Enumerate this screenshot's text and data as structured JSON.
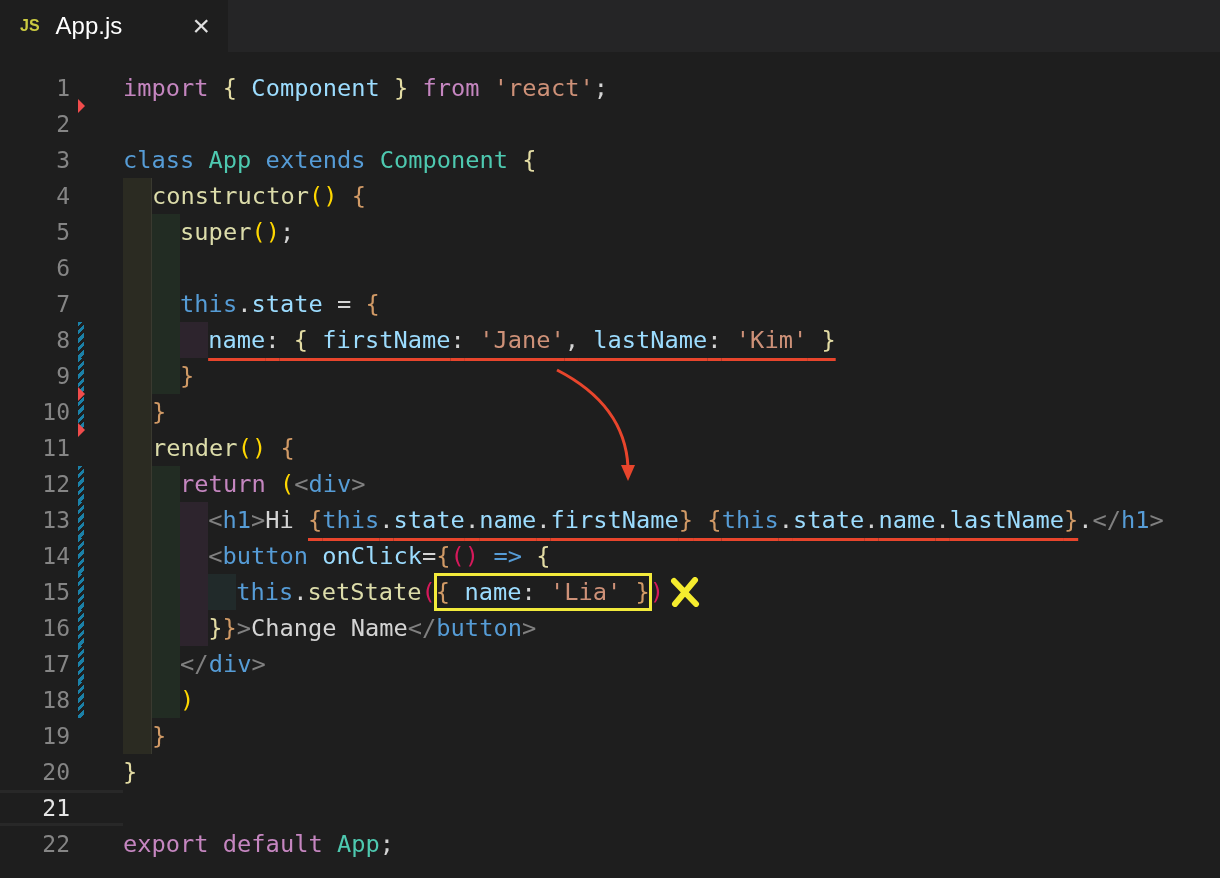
{
  "tabs": [
    {
      "icon_text": "JS",
      "label": "App.js",
      "close": "×",
      "selected": true
    }
  ],
  "lines": [
    {
      "number": "1",
      "modified": false,
      "deleted_after": true,
      "current": false,
      "cross_mark": false,
      "tokens": [
        {
          "text": "import",
          "kind": "kw"
        },
        {
          "text": " {",
          "kind": "b1"
        },
        {
          "text": " Component",
          "kind": "var"
        },
        {
          "text": " }",
          "kind": "b1"
        },
        {
          "text": " from",
          "kind": "kw"
        },
        {
          "text": " 'react'",
          "kind": "str"
        },
        {
          "text": ";",
          "kind": "punc"
        }
      ]
    },
    {
      "number": "2",
      "modified": false,
      "deleted_after": false,
      "current": false,
      "cross_mark": false
    },
    {
      "number": "3",
      "modified": false,
      "deleted_after": false,
      "current": false,
      "cross_mark": false,
      "tokens": [
        {
          "text": "class",
          "kind": "storage"
        },
        {
          "text": " App",
          "kind": "type"
        },
        {
          "text": " extends",
          "kind": "storage"
        },
        {
          "text": " Component",
          "kind": "type"
        },
        {
          "text": " {",
          "kind": "b1"
        }
      ]
    },
    {
      "number": "4",
      "modified": false,
      "deleted_after": false,
      "current": false,
      "cross_mark": false,
      "tokens": [
        {
          "text": "  constructor",
          "kind": "fn"
        },
        {
          "text": "()",
          "kind": "b2"
        },
        {
          "text": " {",
          "kind": "b3"
        }
      ]
    },
    {
      "number": "5",
      "modified": false,
      "deleted_after": false,
      "current": false,
      "cross_mark": false,
      "tokens": [
        {
          "text": "    super",
          "kind": "fn"
        },
        {
          "text": "()",
          "kind": "b2"
        },
        {
          "text": ";",
          "kind": "punc"
        }
      ]
    },
    {
      "number": "6",
      "modified": false,
      "deleted_after": false,
      "current": false,
      "cross_mark": false
    },
    {
      "number": "7",
      "modified": false,
      "deleted_after": false,
      "current": false,
      "cross_mark": false,
      "tokens": [
        {
          "text": "    this",
          "kind": "storage"
        },
        {
          "text": ".",
          "kind": "punc"
        },
        {
          "text": "state",
          "kind": "var"
        },
        {
          "text": " =",
          "kind": "punc"
        },
        {
          "text": " {",
          "kind": "b3"
        }
      ]
    },
    {
      "number": "8",
      "modified": true,
      "deleted_after": false,
      "current": false,
      "cross_mark": false,
      "tokens": [
        {
          "kind": "underline",
          "tokens": [
            {
              "text": "      name",
              "kind": "var"
            },
            {
              "text": ":",
              "kind": "punc"
            },
            {
              "text": " {",
              "kind": "b1"
            },
            {
              "text": " firstName",
              "kind": "var"
            },
            {
              "text": ":",
              "kind": "punc"
            },
            {
              "text": " 'Jane'",
              "kind": "str"
            },
            {
              "text": ",",
              "kind": "punc"
            },
            {
              "text": " lastName",
              "kind": "var"
            },
            {
              "text": ":",
              "kind": "punc"
            },
            {
              "text": " 'Kim'",
              "kind": "str"
            },
            {
              "text": " }",
              "kind": "b1"
            }
          ]
        }
      ]
    },
    {
      "number": "9",
      "modified": true,
      "deleted_after": true,
      "current": false,
      "cross_mark": false,
      "tokens": [
        {
          "text": "    }",
          "kind": "b3"
        }
      ]
    },
    {
      "number": "10",
      "modified": true,
      "deleted_after": true,
      "current": false,
      "cross_mark": false,
      "tokens": [
        {
          "text": "  }",
          "kind": "b3"
        }
      ]
    },
    {
      "number": "11",
      "modified": false,
      "deleted_after": false,
      "current": false,
      "cross_mark": false,
      "tokens": [
        {
          "text": "  render",
          "kind": "fn"
        },
        {
          "text": "()",
          "kind": "b2"
        },
        {
          "text": " {",
          "kind": "b3"
        }
      ]
    },
    {
      "number": "12",
      "modified": true,
      "deleted_after": false,
      "current": false,
      "cross_mark": false,
      "tokens": [
        {
          "text": "    return",
          "kind": "kw"
        },
        {
          "text": " (",
          "kind": "b2"
        },
        {
          "text": "<",
          "kind": "tag"
        },
        {
          "text": "div",
          "kind": "tagname"
        },
        {
          "text": ">",
          "kind": "tag"
        }
      ]
    },
    {
      "number": "13",
      "modified": true,
      "deleted_after": false,
      "current": false,
      "cross_mark": false,
      "tokens": [
        {
          "text": "      <",
          "kind": "tag"
        },
        {
          "text": "h1",
          "kind": "tagname"
        },
        {
          "text": ">",
          "kind": "tag"
        },
        {
          "text": "Hi ",
          "kind": "punc"
        },
        {
          "kind": "underline",
          "tokens": [
            {
              "text": "{",
              "kind": "b3"
            },
            {
              "text": "this",
              "kind": "storage"
            },
            {
              "text": ".",
              "kind": "punc"
            },
            {
              "text": "state",
              "kind": "var"
            },
            {
              "text": ".",
              "kind": "punc"
            },
            {
              "text": "name",
              "kind": "var"
            },
            {
              "text": ".",
              "kind": "punc"
            },
            {
              "text": "firstName",
              "kind": "var"
            },
            {
              "text": "}",
              "kind": "b3"
            },
            {
              "text": " {",
              "kind": "b3"
            },
            {
              "text": "this",
              "kind": "storage"
            },
            {
              "text": ".",
              "kind": "punc"
            },
            {
              "text": "state",
              "kind": "var"
            },
            {
              "text": ".",
              "kind": "punc"
            },
            {
              "text": "name",
              "kind": "var"
            },
            {
              "text": ".",
              "kind": "punc"
            },
            {
              "text": "lastName",
              "kind": "var"
            },
            {
              "text": "}",
              "kind": "b3"
            }
          ]
        },
        {
          "text": ".",
          "kind": "punc"
        },
        {
          "text": "</",
          "kind": "tag"
        },
        {
          "text": "h1",
          "kind": "tagname"
        },
        {
          "text": ">",
          "kind": "tag"
        }
      ]
    },
    {
      "number": "14",
      "modified": true,
      "deleted_after": false,
      "current": false,
      "cross_mark": false,
      "tokens": [
        {
          "text": "      <",
          "kind": "tag"
        },
        {
          "text": "button",
          "kind": "tagname"
        },
        {
          "text": " onClick",
          "kind": "var"
        },
        {
          "text": "=",
          "kind": "punc"
        },
        {
          "text": "{",
          "kind": "b3"
        },
        {
          "text": "()",
          "kind": "b4"
        },
        {
          "text": " =>",
          "kind": "storage"
        },
        {
          "text": " {",
          "kind": "b1"
        }
      ]
    },
    {
      "number": "15",
      "modified": true,
      "deleted_after": false,
      "current": false,
      "cross_mark": true,
      "tokens": [
        {
          "text": "        this",
          "kind": "storage"
        },
        {
          "text": ".",
          "kind": "punc"
        },
        {
          "text": "setState",
          "kind": "fn"
        },
        {
          "text": "(",
          "kind": "b4"
        },
        {
          "kind": "box",
          "tokens": [
            {
              "text": "{",
              "kind": "b3"
            },
            {
              "text": " name",
              "kind": "var"
            },
            {
              "text": ":",
              "kind": "punc"
            },
            {
              "text": " 'Lia'",
              "kind": "str"
            },
            {
              "text": " }",
              "kind": "b3"
            }
          ]
        },
        {
          "text": ")",
          "kind": "b4"
        }
      ]
    },
    {
      "number": "16",
      "modified": true,
      "deleted_after": false,
      "current": false,
      "cross_mark": false,
      "tokens": [
        {
          "text": "      }",
          "kind": "b1"
        },
        {
          "text": "}",
          "kind": "b3"
        },
        {
          "text": ">",
          "kind": "tag"
        },
        {
          "text": "Change Name",
          "kind": "punc"
        },
        {
          "text": "</",
          "kind": "tag"
        },
        {
          "text": "button",
          "kind": "tagname"
        },
        {
          "text": ">",
          "kind": "tag"
        }
      ]
    },
    {
      "number": "17",
      "modified": true,
      "deleted_after": false,
      "current": false,
      "cross_mark": false,
      "tokens": [
        {
          "text": "    </",
          "kind": "tag"
        },
        {
          "text": "div",
          "kind": "tagname"
        },
        {
          "text": ">",
          "kind": "tag"
        }
      ]
    },
    {
      "number": "18",
      "modified": true,
      "deleted_after": false,
      "current": false,
      "cross_mark": false,
      "tokens": [
        {
          "text": "    )",
          "kind": "b2"
        }
      ]
    },
    {
      "number": "19",
      "modified": false,
      "deleted_after": false,
      "current": false,
      "cross_mark": false,
      "tokens": [
        {
          "text": "  }",
          "kind": "b3"
        }
      ]
    },
    {
      "number": "20",
      "modified": false,
      "deleted_after": false,
      "current": false,
      "cross_mark": false,
      "tokens": [
        {
          "text": "}",
          "kind": "b1"
        }
      ]
    },
    {
      "number": "21",
      "modified": false,
      "deleted_after": false,
      "current": true,
      "cross_mark": false
    },
    {
      "number": "22",
      "modified": false,
      "deleted_after": false,
      "current": false,
      "cross_mark": false,
      "tokens": [
        {
          "text": "export",
          "kind": "kw"
        },
        {
          "text": " default",
          "kind": "kw"
        },
        {
          "text": " App",
          "kind": "type"
        },
        {
          "text": ";",
          "kind": "punc"
        }
      ]
    }
  ]
}
